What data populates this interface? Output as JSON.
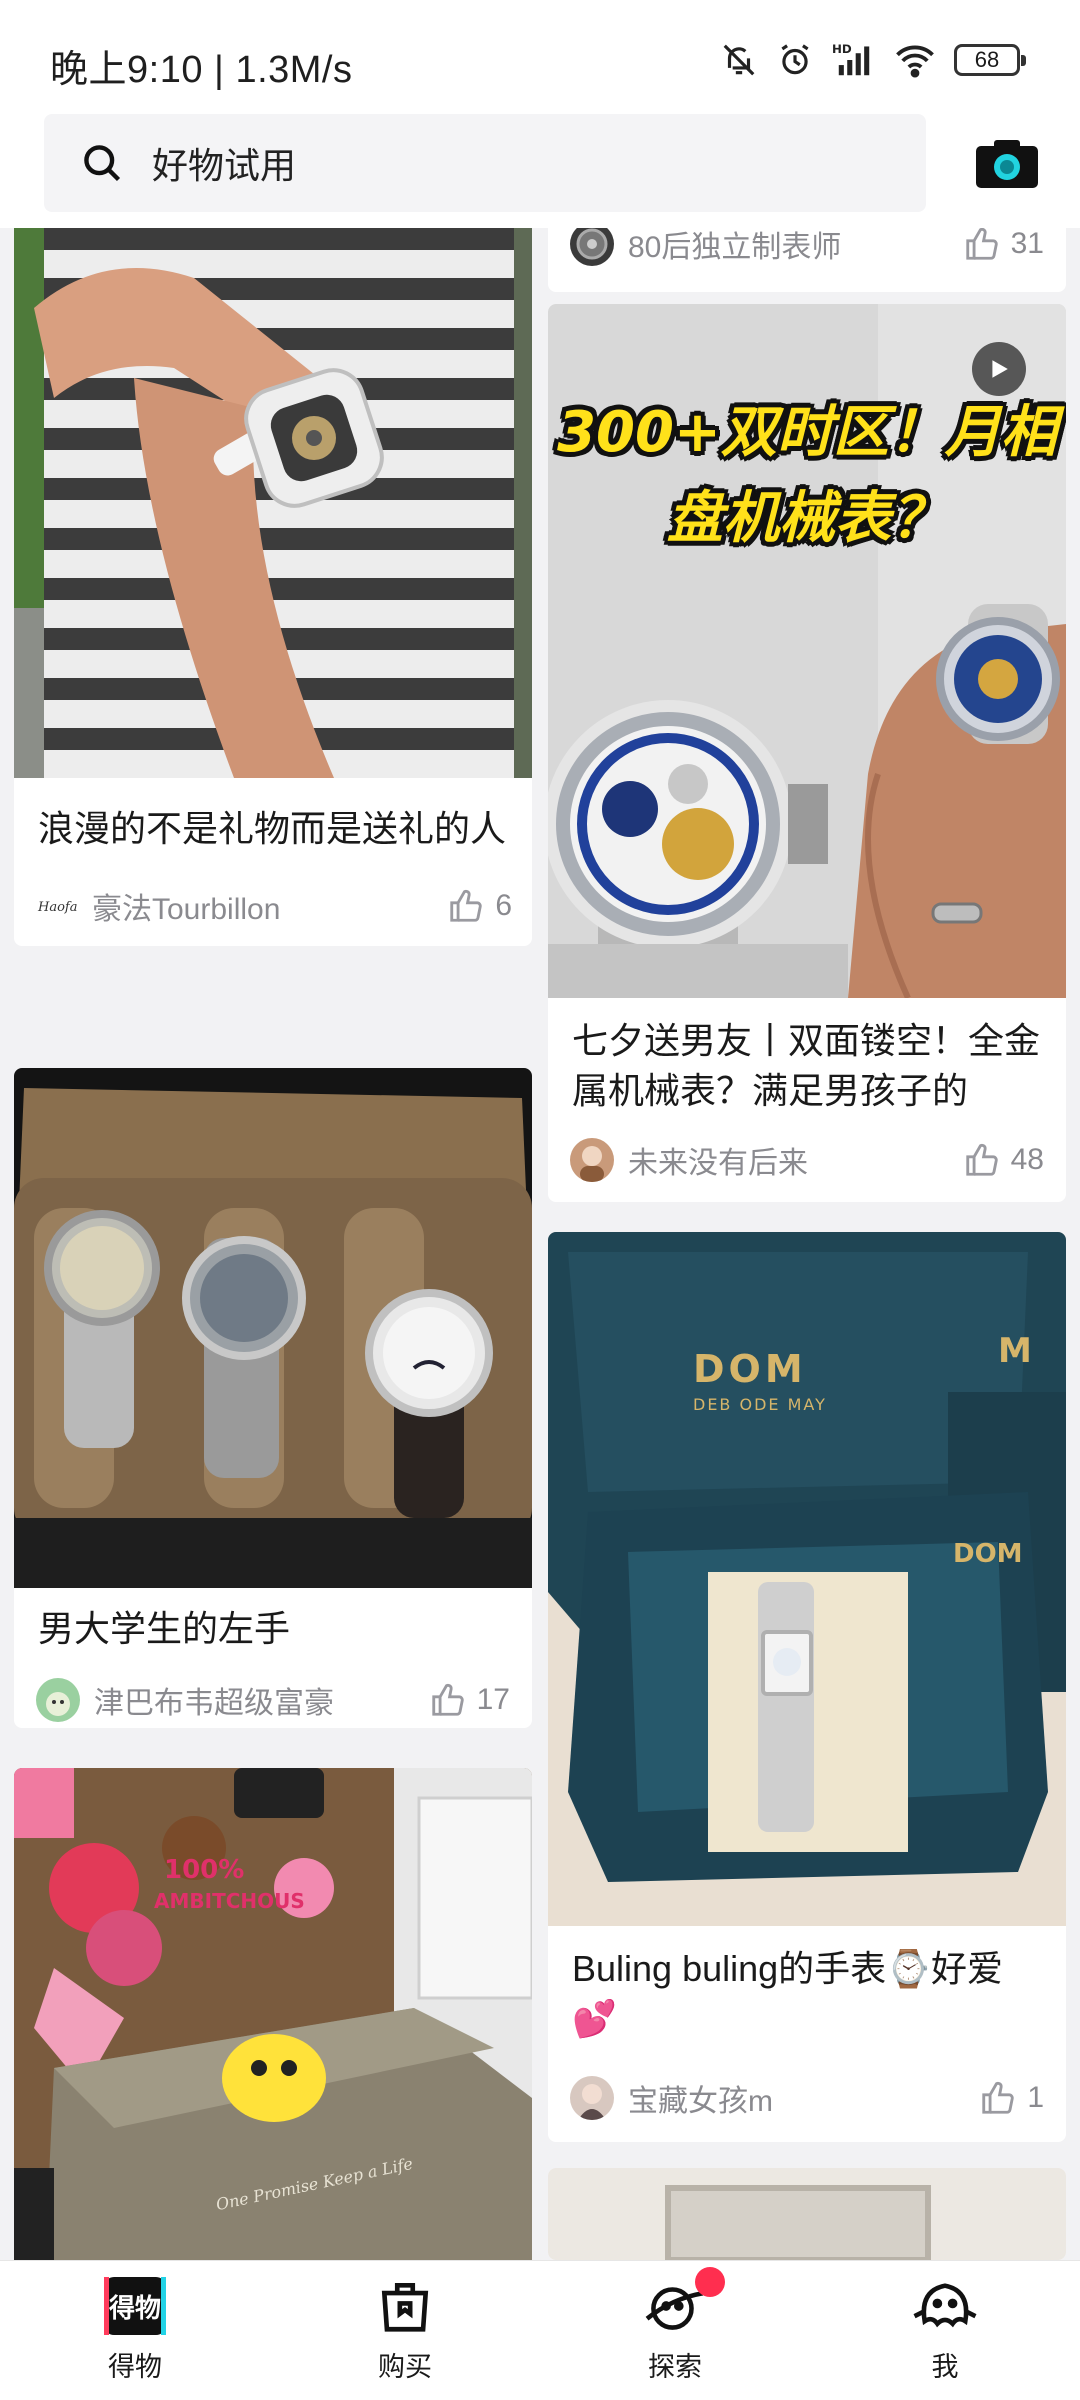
{
  "status_bar": {
    "time": "晚上9:10 | 1.3M/s",
    "battery": "68"
  },
  "search": {
    "text": "好物试用"
  },
  "feed": {
    "left": [
      {
        "title": "浪漫的不是礼物而是送礼的人",
        "author": "豪法Tourbillon",
        "likes": "6"
      },
      {
        "title": "男大学生的左手",
        "author": "津巴布韦超级富豪",
        "likes": "17"
      }
    ],
    "right": [
      {
        "author": "80后独立制表师",
        "likes": "31"
      },
      {
        "overlay_line1": "300+双时区！月相",
        "overlay_line2": "盘机械表？",
        "title": "七夕送男友丨双面镂空！全金属机械表？满足男孩子的",
        "author": "未来没有后来",
        "likes": "48"
      },
      {
        "box_brand": "DOM",
        "box_sub": "DEB ODE MAY",
        "title": "Buling buling的手表⌚好爱💕",
        "author": "宝藏女孩m",
        "likes": "1"
      }
    ],
    "sticker_text": "100% AMBITCHOUS",
    "box_script": "One Promise Keep a Life"
  },
  "nav": {
    "items": [
      {
        "label": "得物",
        "logo": "得物"
      },
      {
        "label": "购买"
      },
      {
        "label": "探索"
      },
      {
        "label": "我"
      }
    ]
  },
  "colors": {
    "accent_badge": "#ff2e4f",
    "camera_lens": "#21d3e0"
  }
}
